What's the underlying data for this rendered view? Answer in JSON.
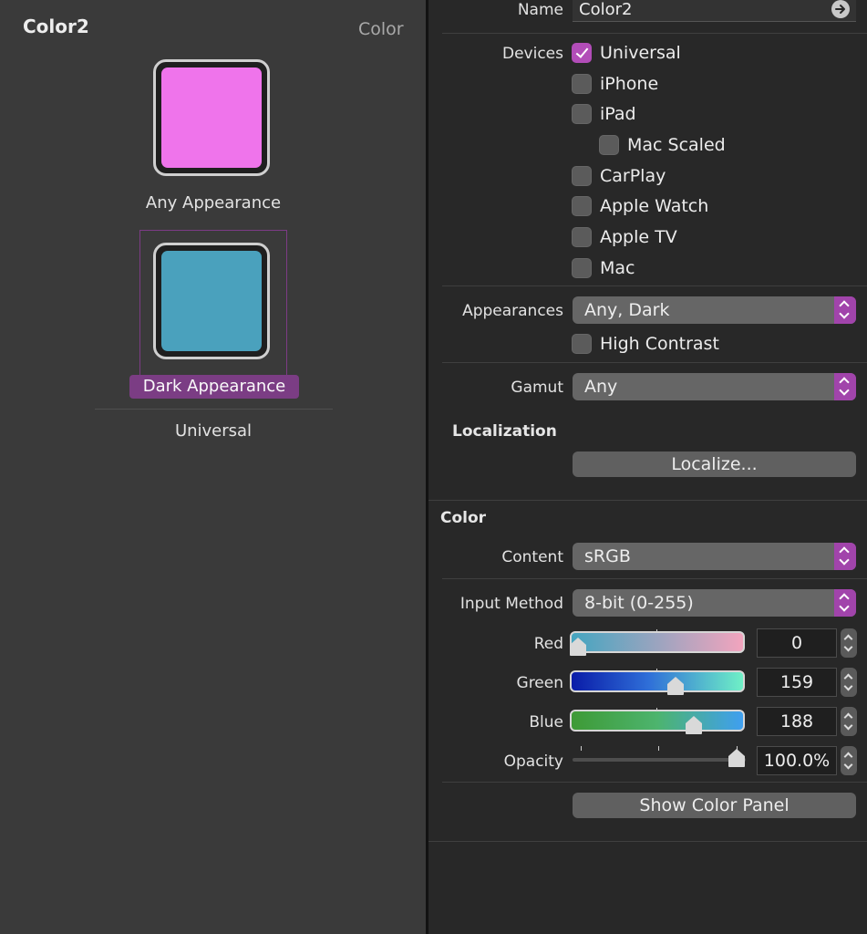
{
  "left": {
    "title": "Color2",
    "subtitle": "Color",
    "wells": [
      {
        "label": "Any Appearance",
        "color": "#ef74eb"
      },
      {
        "label": "Dark Appearance",
        "color": "#4aa1bd"
      }
    ],
    "group_label": "Universal",
    "selection_color": "#7b3d84"
  },
  "inspector": {
    "name_label": "Name",
    "name_value": "Color2",
    "devices_label": "Devices",
    "devices": [
      {
        "label": "Universal",
        "checked": true
      },
      {
        "label": "iPhone",
        "checked": false
      },
      {
        "label": "iPad",
        "checked": false
      },
      {
        "label": "Mac Scaled",
        "checked": false
      },
      {
        "label": "CarPlay",
        "checked": false
      },
      {
        "label": "Apple Watch",
        "checked": false
      },
      {
        "label": "Apple TV",
        "checked": false
      },
      {
        "label": "Mac",
        "checked": false
      }
    ],
    "appearances_label": "Appearances",
    "appearances_value": "Any, Dark",
    "high_contrast_label": "High Contrast",
    "gamut_label": "Gamut",
    "gamut_value": "Any",
    "localization_title": "Localization",
    "localize_button": "Localize...",
    "color_title": "Color",
    "content_label": "Content",
    "content_value": "sRGB",
    "input_method_label": "Input Method",
    "input_method_value": "8-bit (0-255)",
    "sliders": {
      "red": {
        "label": "Red",
        "value": "0",
        "level": 0
      },
      "green": {
        "label": "Green",
        "value": "159",
        "level": 0.6235
      },
      "blue": {
        "label": "Blue",
        "value": "188",
        "level": 0.7373
      },
      "opacity": {
        "label": "Opacity",
        "value": "100.0%",
        "level": 1
      }
    },
    "show_color_panel_button": "Show Color Panel",
    "accent_color": "#a144ab"
  }
}
